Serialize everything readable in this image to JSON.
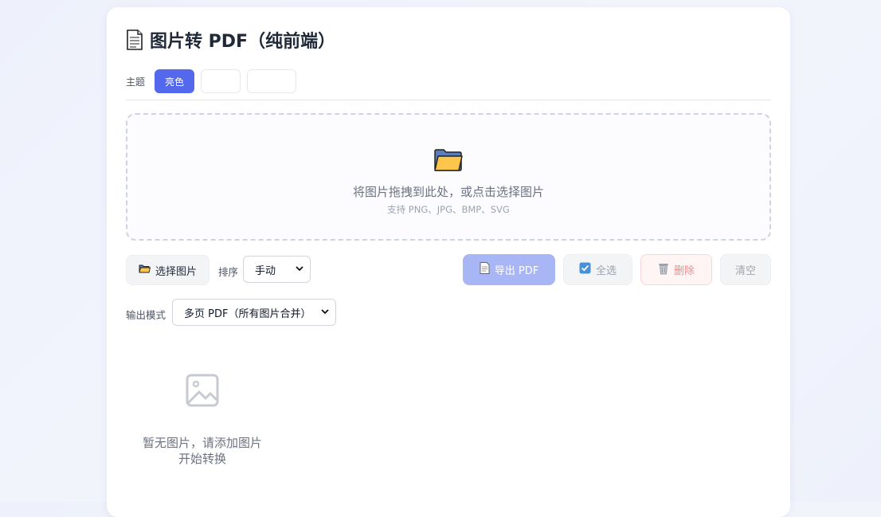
{
  "header": {
    "title": "图片转 PDF（纯前端）",
    "title_icon": "page-icon"
  },
  "theme": {
    "label": "主题",
    "options": [
      {
        "label": "亮色",
        "active": true
      },
      {
        "label": ""
      },
      {
        "label": ""
      }
    ],
    "accent": "#5468ee"
  },
  "dropzone": {
    "icon": "folder-icon",
    "main_text": "将图片拖拽到此处，或点击选择图片",
    "sub_text": "支持 PNG、JPG、BMP、SVG"
  },
  "toolbar": {
    "select_label": "选择图片",
    "sort_label": "排序",
    "sort_value": "手动",
    "export_label": "导出 PDF",
    "select_all_label": "全选",
    "delete_label": "删除",
    "clear_label": "清空"
  },
  "output": {
    "label": "输出模式",
    "value": "多页 PDF（所有图片合并）"
  },
  "empty_state": {
    "icon": "image-placeholder-icon",
    "text": "暂无图片，请添加图片开始转换"
  }
}
